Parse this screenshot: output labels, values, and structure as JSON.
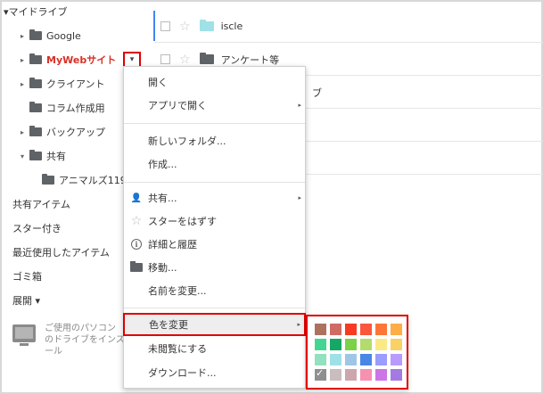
{
  "sidebar": {
    "my_drive": "▾マイドライブ",
    "folders": [
      {
        "label": "Google",
        "expander": "▸"
      },
      {
        "label": "MyWebサイト",
        "expander": "▸"
      },
      {
        "label": "クライアント",
        "expander": "▸"
      },
      {
        "label": "コラム作成用",
        "expander": ""
      },
      {
        "label": "バックアップ",
        "expander": "▸"
      },
      {
        "label": "共有",
        "expander": "▾"
      },
      {
        "label": "アニマルズ119",
        "expander": ""
      }
    ],
    "links": [
      "共有アイテム",
      "スター付き",
      "最近使用したアイテム",
      "ゴミ箱",
      "展開 ▾"
    ],
    "promo_text": "ご使用のパソコン\nのドライブをインス\nール"
  },
  "dropdown_glyph": "▾",
  "files": [
    {
      "name": "iscle",
      "folder_color": "#9fe1e7"
    },
    {
      "name": "アンケート等",
      "folder_color": "#5f6368"
    },
    {
      "name": "ブ",
      "folder_color": "#5f6368"
    }
  ],
  "menu": {
    "items": [
      {
        "label": "開く"
      },
      {
        "label": "アプリで開く",
        "submenu": "▸"
      },
      {
        "label": "新しいフォルダ..."
      },
      {
        "label": "作成..."
      },
      {
        "label": "共有...",
        "submenu": "▸",
        "icon": "add-person-icon",
        "glyph": "👤"
      },
      {
        "label": "スターをはずす",
        "icon": "star-icon",
        "glyph": "☆"
      },
      {
        "label": "詳細と履歴",
        "icon": "info-icon",
        "glyph": "i"
      },
      {
        "label": "移動...",
        "icon": "folder-icon"
      },
      {
        "label": "名前を変更..."
      },
      {
        "label": "色を変更",
        "submenu": "▸"
      },
      {
        "label": "未閲覧にする"
      },
      {
        "label": "ダウンロード..."
      }
    ]
  },
  "palette": {
    "checkmark": "✓",
    "colors": [
      "#ac725e",
      "#d06b64",
      "#f83a22",
      "#fa573c",
      "#ff7537",
      "#ffad46",
      "#42d692",
      "#16a765",
      "#7bd148",
      "#b3dc6c",
      "#fbe983",
      "#fad165",
      "#92e1c0",
      "#9fe1e7",
      "#9fc6e7",
      "#4986e7",
      "#9a9cff",
      "#b99aff",
      "#8f8f8f",
      "#cabdbf",
      "#cca6ac",
      "#f691b2",
      "#cd74e6",
      "#a47ae2"
    ],
    "selected_index": 18
  }
}
